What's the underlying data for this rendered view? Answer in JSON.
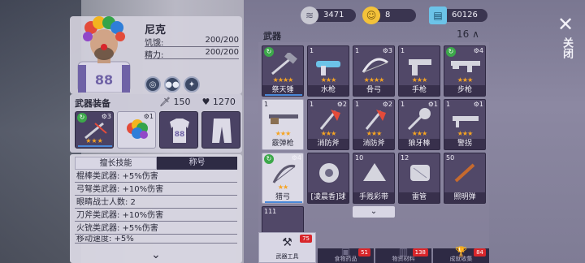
{
  "character": {
    "name": "尼克",
    "hunger_label": "饥饿:",
    "hunger_value": "200/200",
    "energy_label": "精力:",
    "energy_value": "200/200",
    "jersey_number": "88",
    "status_icons": [
      "stomach-icon",
      "group-icon",
      "figure-icon"
    ]
  },
  "equipment": {
    "title": "武器装备",
    "attack_value": "150",
    "health_value": "1270",
    "slots": [
      {
        "kind": "weapon",
        "mods": "3",
        "stars": 3
      },
      {
        "kind": "afro-wig",
        "mods": "1"
      },
      {
        "kind": "jersey",
        "jersey_number": "88"
      },
      {
        "kind": "pants"
      }
    ]
  },
  "skills": {
    "tab_active": "擅长技能",
    "tab_inactive": "称号",
    "lines": [
      "棍棒类武器: +5%伤害",
      "弓弩类武器: +10%伤害",
      "眼睛战士人数: 2",
      "刀斧类武器: +10%伤害",
      "火铳类武器: +5%伤害",
      "移动速度: +5%"
    ],
    "more_icon": "chevron-down-icon"
  },
  "currencies": [
    {
      "icon": "coin-stack-icon",
      "value": "3471",
      "color": "#c8c8d2"
    },
    {
      "icon": "smiley-coin-icon",
      "value": "8",
      "color": "#f3c23a"
    },
    {
      "icon": "cash-icon",
      "value": "60126",
      "color": "#6cc3e8"
    }
  ],
  "close": {
    "label": "关闭",
    "icon": "close-icon"
  },
  "weapons": {
    "title": "武器",
    "count": "16",
    "collapse_icon": "chevron-up-icon",
    "items": [
      {
        "name": "祭天锤",
        "qty": "",
        "mods": "",
        "stars": 4,
        "refresh": true,
        "icon": "hammer-icon",
        "light": false,
        "bar": 100
      },
      {
        "name": "水枪",
        "qty": "1",
        "mods": "",
        "stars": 3,
        "refresh": false,
        "icon": "water-gun-icon",
        "light": false,
        "bar": 0
      },
      {
        "name": "骨弓",
        "qty": "1",
        "mods": "3",
        "stars": 4,
        "refresh": false,
        "icon": "bone-bow-icon",
        "light": false,
        "bar": 0
      },
      {
        "name": "手枪",
        "qty": "1",
        "mods": "",
        "stars": 3,
        "refresh": false,
        "icon": "pistol-icon",
        "light": false,
        "bar": 0
      },
      {
        "name": "步枪",
        "qty": "",
        "mods": "4",
        "stars": 3,
        "refresh": true,
        "icon": "rifle-icon",
        "light": false,
        "bar": 0
      },
      {
        "name": "霰弹枪",
        "qty": "1",
        "mods": "",
        "stars": 3,
        "refresh": false,
        "icon": "shotgun-icon",
        "light": true,
        "bar": 0
      },
      {
        "name": "消防斧",
        "qty": "1",
        "mods": "2",
        "stars": 3,
        "refresh": false,
        "icon": "fire-axe-icon",
        "light": false,
        "bar": 0
      },
      {
        "name": "消防斧",
        "qty": "1",
        "mods": "2",
        "stars": 3,
        "refresh": false,
        "icon": "fire-axe-icon",
        "light": false,
        "bar": 0
      },
      {
        "name": "狼牙棒",
        "qty": "1",
        "mods": "1",
        "stars": 3,
        "refresh": false,
        "icon": "mace-icon",
        "light": false,
        "bar": 0
      },
      {
        "name": "警拐",
        "qty": "1",
        "mods": "1",
        "stars": 3,
        "refresh": false,
        "icon": "baton-icon",
        "light": false,
        "bar": 0
      },
      {
        "name": "猎弓",
        "qty": "",
        "mods": "4",
        "stars": 2,
        "refresh": true,
        "icon": "hunting-bow-icon",
        "light": true,
        "bar": 100
      },
      {
        "name": "[凌晨香]球",
        "qty": "",
        "mods": "",
        "stars": 0,
        "refresh": false,
        "icon": "bomb-icon",
        "light": false,
        "bar": 0
      },
      {
        "name": "手贱彩带",
        "qty": "10",
        "mods": "",
        "stars": 0,
        "refresh": false,
        "icon": "ribbon-icon",
        "light": false,
        "bar": 0
      },
      {
        "name": "雷管",
        "qty": "12",
        "mods": "",
        "stars": 0,
        "refresh": false,
        "icon": "detonator-icon",
        "light": false,
        "bar": 0
      },
      {
        "name": "照明弹",
        "qty": "50",
        "mods": "",
        "stars": 0,
        "refresh": false,
        "icon": "flare-icon",
        "light": false,
        "bar": 0
      },
      {
        "name": "",
        "qty": "111",
        "mods": "",
        "stars": 0,
        "refresh": false,
        "icon": "",
        "light": false,
        "bar": 0
      }
    ],
    "scroll_icon": "chevron-down-icon"
  },
  "bottom_tabs": [
    {
      "label": "武器工具",
      "badge": "75",
      "icon": "tools-icon",
      "active": true
    },
    {
      "label": "食物药品",
      "badge": "51",
      "icon": "food-icon",
      "active": false
    },
    {
      "label": "物资材料",
      "badge": "138",
      "icon": "materials-icon",
      "active": false
    },
    {
      "label": "成就收集",
      "badge": "84",
      "icon": "trophy-icon",
      "active": false
    }
  ]
}
